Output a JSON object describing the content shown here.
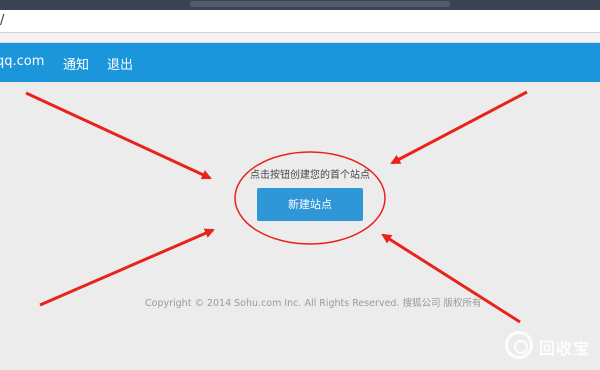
{
  "browser": {
    "url": "/"
  },
  "navbar": {
    "brand": "qq.com",
    "notice": "通知",
    "logout": "退出"
  },
  "main": {
    "prompt": "点击按钮创建您的首个站点",
    "new_site_button": "新建站点"
  },
  "footer": {
    "copyright": "Copyright © 2014 Sohu.com Inc. All Rights Reserved. 搜狐公司 版权所有"
  },
  "watermark": {
    "text": "回收宝",
    "icon": "recycle-logo-icon"
  },
  "colors": {
    "navbar": "#1c96db",
    "button": "#2f97d8",
    "annotation": "#e8231a"
  }
}
